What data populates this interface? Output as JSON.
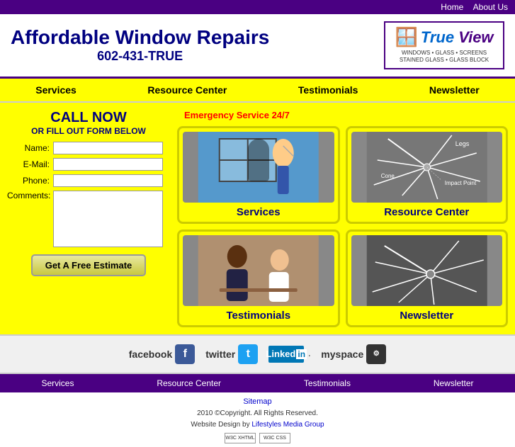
{
  "topbar": {
    "home_label": "Home",
    "about_label": "About Us"
  },
  "header": {
    "title": "Affordable Window Repairs",
    "phone": "602-431-TRUE",
    "logo_line1": "True View",
    "logo_sub": "WINDOWS • GLASS • SCREENS\nSTAINED GLASS • GLASS BLOCK"
  },
  "nav": {
    "items": [
      {
        "label": "Services",
        "href": "#"
      },
      {
        "label": "Resource Center",
        "href": "#"
      },
      {
        "label": "Testimonials",
        "href": "#"
      },
      {
        "label": "Newsletter",
        "href": "#"
      }
    ]
  },
  "form": {
    "call_now": "CALL NOW",
    "or_fill": "OR FILL OUT FORM BELOW",
    "name_label": "Name:",
    "email_label": "E-Mail:",
    "phone_label": "Phone:",
    "comments_label": "Comments:",
    "submit_label": "Get A Free Estimate"
  },
  "grid": {
    "emergency_text": "Emergency Service 24/7",
    "cards": [
      {
        "id": "services",
        "label": "Services"
      },
      {
        "id": "resource",
        "label": "Resource Center"
      },
      {
        "id": "testimonials",
        "label": "Testimonials"
      },
      {
        "id": "newsletter",
        "label": "Newsletter"
      }
    ]
  },
  "social": {
    "items": [
      {
        "name": "facebook",
        "label": "facebook",
        "icon": "f"
      },
      {
        "name": "twitter",
        "label": "twitter",
        "icon": "t"
      },
      {
        "name": "linkedin",
        "label": "Linked",
        "icon_suffix": "in"
      },
      {
        "name": "myspace",
        "label": "myspace",
        "icon": "m"
      }
    ]
  },
  "bottom_nav": {
    "items": [
      {
        "label": "Services"
      },
      {
        "label": "Resource Center"
      },
      {
        "label": "Testimonials"
      },
      {
        "label": "Newsletter"
      }
    ]
  },
  "footer": {
    "sitemap": "Sitemap",
    "copyright": "2010 ©Copyright. All Rights Reserved.",
    "design": "Website Design by Lifestyles Media Group"
  }
}
